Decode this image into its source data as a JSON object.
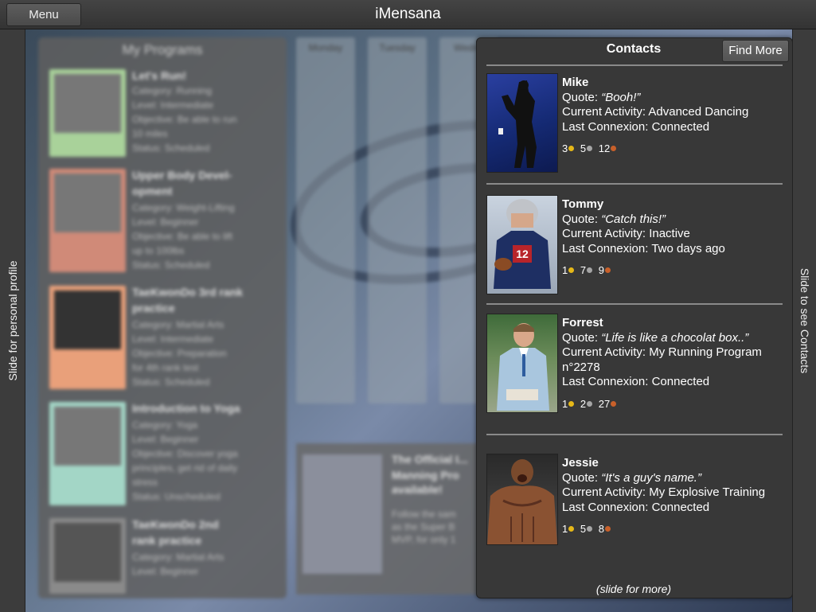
{
  "app": {
    "title": "iMensana",
    "menu_label": "Menu"
  },
  "rails": {
    "left_label": "Slide for personal profile",
    "right_label": "Slide to see Contacts"
  },
  "background": {
    "programs_title": "My Programs",
    "days": [
      "Monday",
      "Tuesday",
      "Wedne"
    ],
    "programs": [
      {
        "title": "Let's Run!",
        "lines": [
          "Category: Running",
          "Level: Intermediate",
          "Objective: Be able to run",
          "10 miles",
          "Status: Scheduled"
        ],
        "color": "#a9d29a"
      },
      {
        "title": "Upper Body Devel-",
        "title2": "opment",
        "lines": [
          "Category: Weight-Lifting",
          "Level: Beginner",
          "Objective: Be able to lift",
          "up to 100lbs",
          "Status: Scheduled"
        ],
        "color": "#d08a78"
      },
      {
        "title": "TaeKwonDo 3rd rank",
        "title2": "practice",
        "lines": [
          "Category: Martial Arts",
          "Level: Intermediate",
          "Objective: Preparation",
          "for 4th rank test",
          "Status: Scheduled"
        ],
        "color": "#e9a07a"
      },
      {
        "title": "Introduction to Yoga",
        "lines": [
          "Category: Yoga",
          "Level: Beginner",
          "Objective: Discover yoga",
          "principles, get rid of daily",
          "stress",
          "Status: Unscheduled"
        ],
        "color": "#a3d6c6"
      },
      {
        "title": "TaeKwonDo 2nd",
        "title2": "rank practice",
        "lines": [
          "Category: Martial Arts",
          "Level: Beginner"
        ],
        "color": "#8a8a8a"
      }
    ],
    "news_title": "The Official I...",
    "news_lines": [
      "Manning Pro",
      "available!",
      "Follow the sam",
      "as the Super B",
      "MVP, for only 1"
    ]
  },
  "contacts": {
    "title": "Contacts",
    "find_more_label": "Find More",
    "items": [
      {
        "name": "Mike",
        "quote_label": "Quote:",
        "quote": "“Booh!”",
        "activity_label": "Current Activity:",
        "activity": "Advanced Dancing",
        "connexion_label": "Last Connexion:",
        "connexion": "Connected",
        "gold": "3",
        "silver": "5",
        "bronze": "12"
      },
      {
        "name": "Tommy",
        "quote_label": "Quote:",
        "quote": "“Catch this!”",
        "activity_label": "Current Activity:",
        "activity": "Inactive",
        "connexion_label": "Last Connexion:",
        "connexion": "Two days ago",
        "gold": "1",
        "silver": "7",
        "bronze": "9"
      },
      {
        "name": "Forrest",
        "quote_label": "Quote:",
        "quote": "“Life is like a chocolat box..”",
        "activity_label": "Current Activity:",
        "activity": "My Running Program",
        "activity_cont": "n°2278",
        "connexion_label": "Last Connexion:",
        "connexion": "Connected",
        "gold": "1",
        "silver": "2",
        "bronze": "27"
      },
      {
        "name": "Jessie",
        "quote_label": "Quote:",
        "quote": "“It's a guy's name.”",
        "activity_label": "Current Activity:",
        "activity": "My Explosive Training",
        "connexion_label": "Last Connexion:",
        "connexion": "Connected",
        "gold": "1",
        "silver": "5",
        "bronze": "8"
      }
    ],
    "slide_more": "(slide for more)"
  },
  "colors": {
    "gold": "#e6b818",
    "silver": "#a5a5a5",
    "bronze": "#c8602a"
  }
}
